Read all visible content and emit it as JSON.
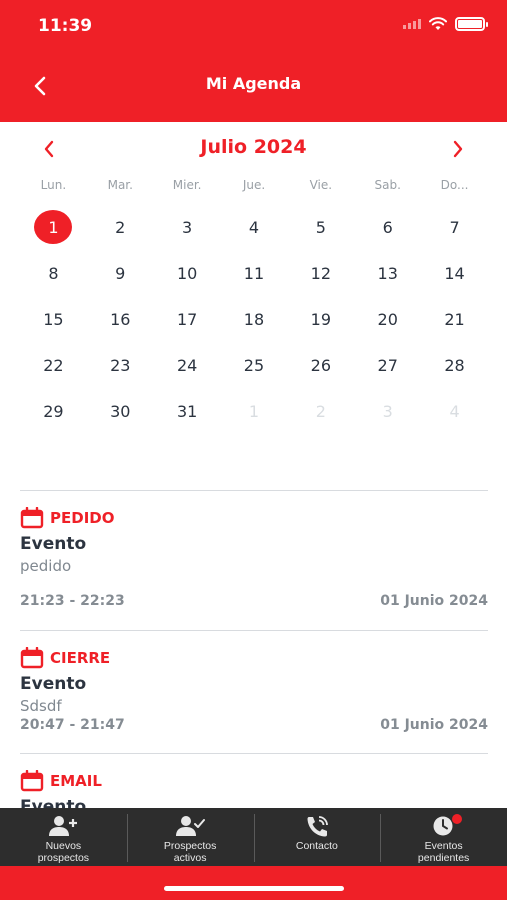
{
  "status": {
    "time": "11:39"
  },
  "nav": {
    "title": "Mi Agenda"
  },
  "calendar": {
    "month_label": "Julio 2024",
    "weekdays": [
      "Lun.",
      "Mar.",
      "Mier.",
      "Jue.",
      "Vie.",
      "Sab.",
      "Do..."
    ],
    "days": [
      {
        "n": "1",
        "muted": false,
        "selected": true
      },
      {
        "n": "2",
        "muted": false
      },
      {
        "n": "3",
        "muted": false
      },
      {
        "n": "4",
        "muted": false
      },
      {
        "n": "5",
        "muted": false
      },
      {
        "n": "6",
        "muted": false
      },
      {
        "n": "7",
        "muted": false
      },
      {
        "n": "8",
        "muted": false
      },
      {
        "n": "9",
        "muted": false
      },
      {
        "n": "10",
        "muted": false
      },
      {
        "n": "11",
        "muted": false
      },
      {
        "n": "12",
        "muted": false
      },
      {
        "n": "13",
        "muted": false
      },
      {
        "n": "14",
        "muted": false
      },
      {
        "n": "15",
        "muted": false
      },
      {
        "n": "16",
        "muted": false
      },
      {
        "n": "17",
        "muted": false
      },
      {
        "n": "18",
        "muted": false
      },
      {
        "n": "19",
        "muted": false
      },
      {
        "n": "20",
        "muted": false
      },
      {
        "n": "21",
        "muted": false
      },
      {
        "n": "22",
        "muted": false
      },
      {
        "n": "23",
        "muted": false
      },
      {
        "n": "24",
        "muted": false
      },
      {
        "n": "25",
        "muted": false
      },
      {
        "n": "26",
        "muted": false
      },
      {
        "n": "27",
        "muted": false
      },
      {
        "n": "28",
        "muted": false
      },
      {
        "n": "29",
        "muted": false
      },
      {
        "n": "30",
        "muted": false
      },
      {
        "n": "31",
        "muted": false
      },
      {
        "n": "1",
        "muted": true
      },
      {
        "n": "2",
        "muted": true
      },
      {
        "n": "3",
        "muted": true
      },
      {
        "n": "4",
        "muted": true
      }
    ]
  },
  "events": [
    {
      "type": "PEDIDO",
      "title": "Evento",
      "description": "pedido",
      "time": "21:23 - 22:23",
      "date": "01 Junio 2024"
    },
    {
      "type": "CIERRE",
      "title": "Evento",
      "description": "Sdsdf",
      "time": "20:47 - 21:47",
      "date": "01 Junio 2024"
    },
    {
      "type": "EMAIL",
      "title": "Evento",
      "description": "",
      "time": "",
      "date": ""
    }
  ],
  "tabs": [
    {
      "icon": "add-person-icon",
      "label": "Nuevos prospectos"
    },
    {
      "icon": "person-check-icon",
      "label": "Prospectos activos"
    },
    {
      "icon": "phone-icon",
      "label": "Contacto"
    },
    {
      "icon": "clock-icon",
      "label": "Eventos pendientes"
    }
  ],
  "colors": {
    "brand_red": "#ef2027",
    "tab_bar": "#2d2d2d",
    "text_dark": "#2c3440"
  }
}
